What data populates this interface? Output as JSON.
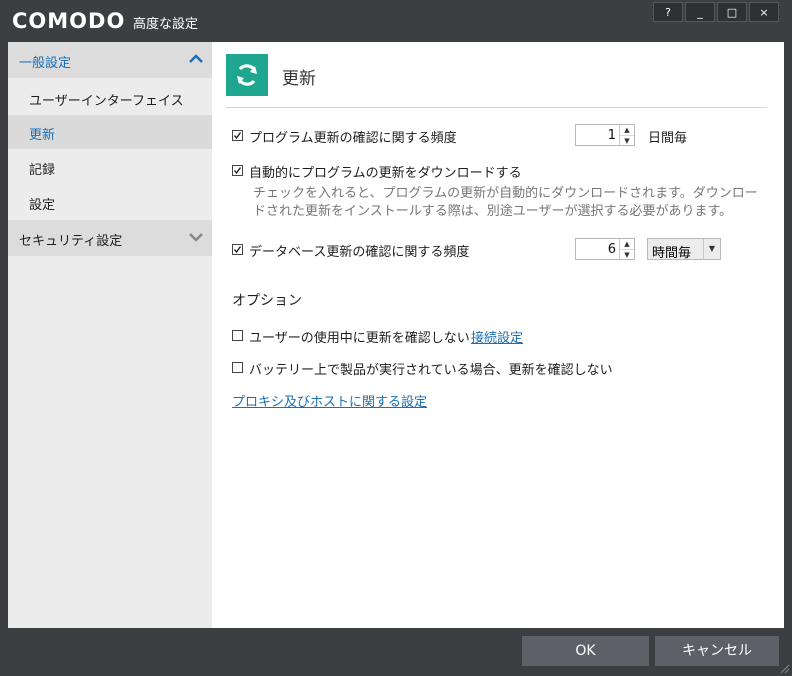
{
  "window": {
    "logo": "COMODO",
    "title": "高度な設定",
    "buttons": {
      "help": "?",
      "minimize": "_",
      "maximize": "□",
      "close": "×"
    }
  },
  "sidebar": {
    "groups": [
      {
        "label": "一般設定",
        "expanded": true,
        "items": [
          {
            "label": "ユーザーインターフェイス"
          },
          {
            "label": "更新",
            "active": true
          },
          {
            "label": "記録"
          },
          {
            "label": "設定"
          }
        ]
      },
      {
        "label": "セキュリティ設定",
        "expanded": false
      }
    ]
  },
  "page": {
    "title": "更新",
    "icon": "refresh-icon",
    "accent_color": "#1ea690",
    "program_update": {
      "label": "プログラム更新の確認に関する頻度",
      "checked": true,
      "value": "1",
      "unit": "日間毎"
    },
    "auto_download": {
      "label": "自動的にプログラムの更新をダウンロードする",
      "checked": true,
      "desc_line1": "チェックを入れると、プログラムの更新が自動的にダウンロードされます。ダウンロー",
      "desc_line2": "ドされた更新をインストールする際は、別途ユーザーが選択する必要があります。"
    },
    "db_update": {
      "label": "データベース更新の確認に関する頻度",
      "checked": true,
      "value": "6",
      "unit": "時間毎"
    },
    "options_heading": "オプション",
    "no_check_in_use": {
      "label": "ユーザーの使用中に更新を確認しない",
      "checked": false,
      "link": "接続設定"
    },
    "no_check_battery": {
      "label": "バッテリー上で製品が実行されている場合、更新を確認しない",
      "checked": false
    },
    "proxy_link": "プロキシ及びホストに関する設定"
  },
  "footer": {
    "ok": "OK",
    "cancel": "キャンセル"
  }
}
